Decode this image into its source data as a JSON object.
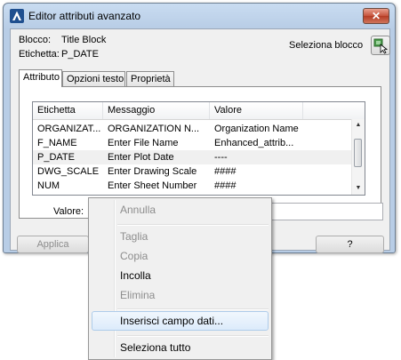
{
  "window": {
    "title": "Editor attributi avanzato"
  },
  "info": {
    "block_label": "Blocco:",
    "block_value": "Title Block",
    "tag_label": "Etichetta:",
    "tag_value": "P_DATE",
    "select_block_label": "Seleziona blocco"
  },
  "tabs": [
    {
      "label": "Attributo",
      "active": true
    },
    {
      "label": "Opzioni testo",
      "active": false
    },
    {
      "label": "Proprietà",
      "active": false
    }
  ],
  "grid": {
    "columns": [
      "Etichetta",
      "Messaggio",
      "Valore"
    ],
    "rows": [
      {
        "tag": "ORGANIZAT...",
        "prompt": "ORGANIZATION N...",
        "value": "Organization Name"
      },
      {
        "tag": "F_NAME",
        "prompt": "Enter File Name",
        "value": "Enhanced_attrib..."
      },
      {
        "tag": "P_DATE",
        "prompt": "Enter Plot Date",
        "value": "----"
      },
      {
        "tag": "DWG_SCALE",
        "prompt": "Enter Drawing Scale",
        "value": "####"
      },
      {
        "tag": "NUM",
        "prompt": "Enter Sheet Number",
        "value": "####"
      }
    ]
  },
  "value_field": {
    "label": "Valore:",
    "value": ""
  },
  "buttons": {
    "apply": "Applica",
    "help": "?"
  },
  "context_menu": {
    "items": [
      {
        "label": "Annulla",
        "enabled": false
      },
      {
        "label": "Taglia",
        "enabled": false
      },
      {
        "label": "Copia",
        "enabled": false
      },
      {
        "label": "Incolla",
        "enabled": true
      },
      {
        "label": "Elimina",
        "enabled": false
      },
      {
        "label": "Inserisci campo dati...",
        "enabled": true,
        "highlighted": true
      },
      {
        "label": "Seleziona tutto",
        "enabled": true
      }
    ]
  },
  "colors": {
    "title_bg": "#b8cde6",
    "close_button": "#c5523a",
    "menu_highlight": "#dcebfb",
    "app_icon": "#1f4f8f"
  },
  "icons": {
    "app": "autocad-a-icon",
    "select_block": "pick-block-cursor-icon"
  }
}
